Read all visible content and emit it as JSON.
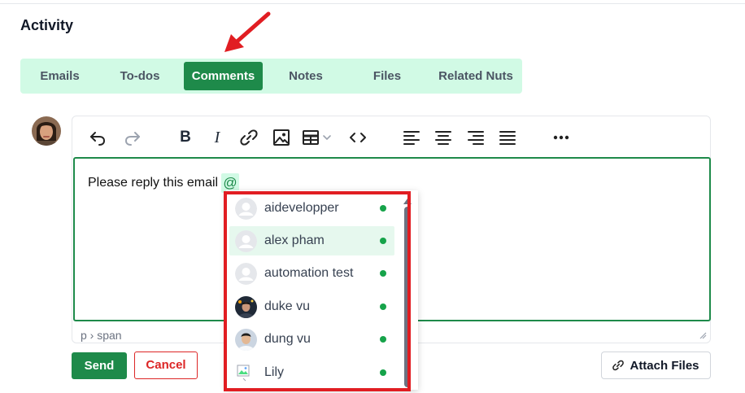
{
  "section": {
    "title": "Activity"
  },
  "tabs": [
    {
      "label": "Emails"
    },
    {
      "label": "To-dos"
    },
    {
      "label": "Comments",
      "active": true
    },
    {
      "label": "Notes"
    },
    {
      "label": "Files"
    },
    {
      "label": "Related Nuts"
    }
  ],
  "toolbar": {
    "icons": [
      "undo-icon",
      "redo-icon",
      "bold-icon",
      "italic-icon",
      "link-icon",
      "image-icon",
      "table-icon",
      "code-icon",
      "align-left-icon",
      "align-center-icon",
      "align-right-icon",
      "align-justify-icon",
      "more-icon"
    ],
    "bold_glyph": "B",
    "italic_glyph": "I"
  },
  "editor": {
    "content": "Please reply this email",
    "mention_trigger": "@",
    "statusbar": "p › span"
  },
  "mentions": [
    {
      "name": "aidevelopper",
      "online": true,
      "avatar": "placeholder"
    },
    {
      "name": "alex pham",
      "online": true,
      "avatar": "placeholder",
      "hovered": true
    },
    {
      "name": "automation test",
      "online": true,
      "avatar": "placeholder"
    },
    {
      "name": "duke vu",
      "online": true,
      "avatar": "photo"
    },
    {
      "name": "dung vu",
      "online": true,
      "avatar": "photo"
    },
    {
      "name": "Lily",
      "online": true,
      "avatar": "broken-image"
    }
  ],
  "buttons": {
    "send": "Send",
    "cancel": "Cancel",
    "attach": "Attach Files"
  },
  "colors": {
    "accent": "#1e8a4a",
    "tab_bar": "#d1fae5",
    "cancel": "#dc2626",
    "annotation": "#e11d22",
    "online": "#16a34a"
  }
}
